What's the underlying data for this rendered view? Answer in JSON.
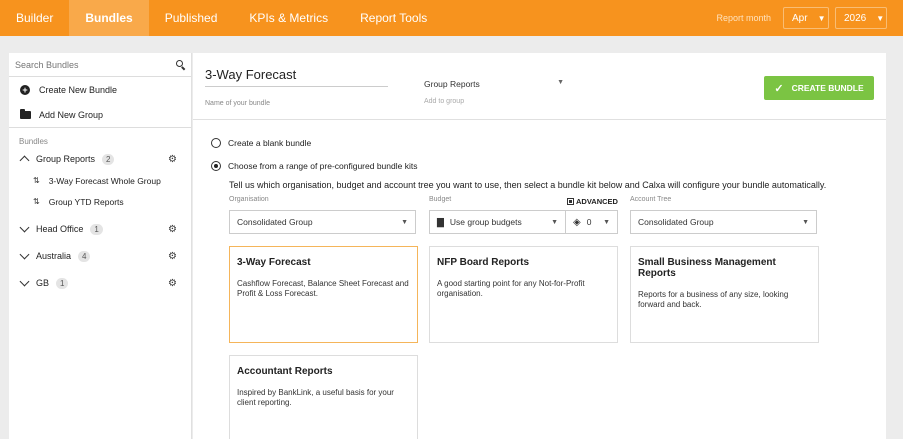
{
  "nav": {
    "tabs": [
      "Builder",
      "Bundles",
      "Published",
      "KPIs & Metrics",
      "Report Tools"
    ],
    "active_tab": "Bundles",
    "report_month_label": "Report month",
    "month": "Apr",
    "year": "2026"
  },
  "sidebar": {
    "search_placeholder": "Search Bundles",
    "create_new_bundle": "Create New Bundle",
    "add_new_group": "Add New Group",
    "section_title": "Bundles",
    "groups": [
      {
        "name": "Group Reports",
        "count": "2",
        "expanded": true
      },
      {
        "name": "Head Office",
        "count": "1",
        "expanded": false
      },
      {
        "name": "Australia",
        "count": "4",
        "expanded": false
      },
      {
        "name": "GB",
        "count": "1",
        "expanded": false
      }
    ],
    "group_reports_items": [
      "3-Way Forecast Whole Group",
      "Group YTD Reports"
    ]
  },
  "main": {
    "bundle_name": "3-Way Forecast",
    "bundle_name_hint": "Name of your bundle",
    "group_select": "Group Reports",
    "group_hint": "Add to group",
    "create_button": "CREATE BUNDLE",
    "radio_blank": "Create a blank bundle",
    "radio_kits": "Choose from a range of pre-configured bundle kits",
    "selected_option": "kits",
    "instructions": "Tell us which organisation, budget and account tree you want to use, then select a bundle kit below and Calxa will configure your bundle automatically.",
    "organisation_label": "Organisation",
    "organisation_value": "Consolidated Group",
    "budget_label": "Budget",
    "budget_value": "Use group budgets",
    "advanced_label": "ADVANCED",
    "layers_value": "0",
    "account_tree_label": "Account Tree",
    "account_tree_value": "Consolidated Group",
    "cards": [
      {
        "title": "3-Way Forecast",
        "desc": "Cashflow Forecast, Balance Sheet Forecast and Profit & Loss Forecast.",
        "selected": true
      },
      {
        "title": "NFP Board Reports",
        "desc": "A good starting point for any Not-for-Profit organisation.",
        "selected": false
      },
      {
        "title": "Small Business Management Reports",
        "desc": "Reports for a business of any size, looking forward and back.",
        "selected": false
      },
      {
        "title": "Accountant Reports",
        "desc": "Inspired by BankLink, a useful basis for your client reporting.",
        "selected": false
      }
    ]
  },
  "colors": {
    "brand_orange": "#f7931e",
    "active_tab": "#f9a94a",
    "create_green": "#7bc443",
    "selected_card_border": "#f5b55a"
  }
}
